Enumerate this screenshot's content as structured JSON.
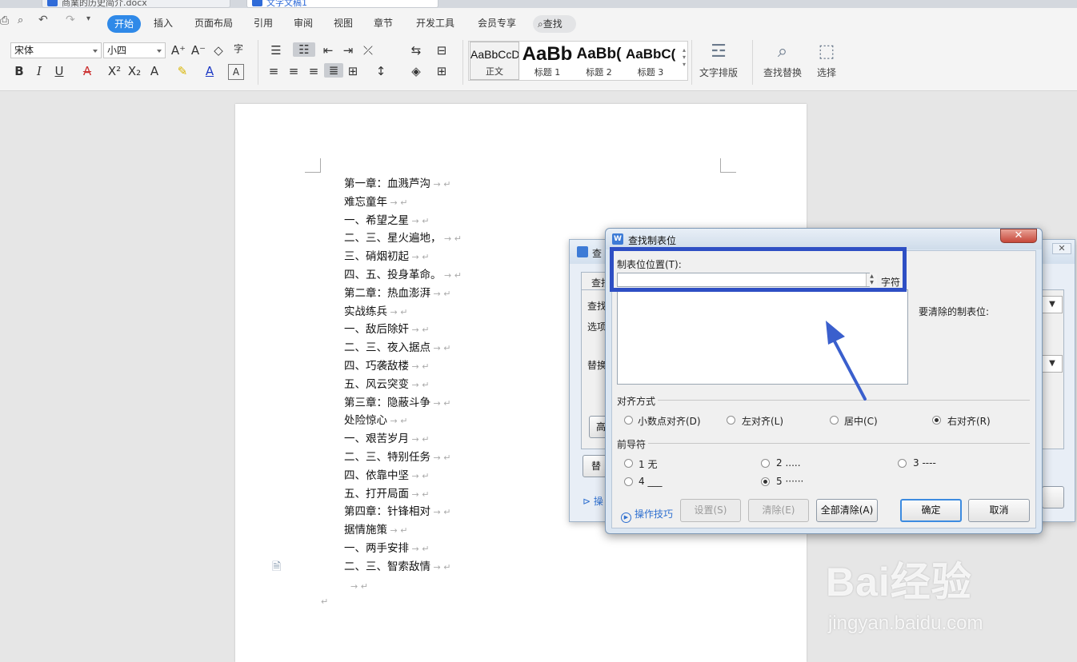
{
  "tabs": [
    {
      "label": "商業的历史简介.docx",
      "active": false
    },
    {
      "label": "文字文稿1",
      "active": true
    }
  ],
  "menu": {
    "items": [
      "插入",
      "页面布局",
      "引用",
      "审阅",
      "视图",
      "章节",
      "开发工具",
      "会员专享"
    ],
    "active": "开始",
    "search": "查找"
  },
  "ribbon": {
    "font_name": "宋体",
    "font_size": "小四",
    "styles": [
      {
        "preview": "AaBbCcD",
        "name": "正文"
      },
      {
        "preview": "AaBb",
        "name": "标题 1"
      },
      {
        "preview": "AaBb(",
        "name": "标题 2"
      },
      {
        "preview": "AaBbC(",
        "name": "标题 3"
      }
    ],
    "text_layout": "文字排版",
    "find_replace": "查找替换",
    "select": "选择"
  },
  "document": {
    "lines": [
      "第一章：血溅芦沟",
      "难忘童年",
      "一、希望之星",
      "二、三、星火遍地，",
      "三、硝烟初起",
      "四、五、投身革命。",
      "第二章：热血澎湃",
      "实战练兵",
      "一、敌后除奸",
      "二、三、夜入据点",
      "四、巧袭敌楼",
      "五、风云突变",
      "第三章：隐蔽斗争",
      "处险惊心",
      "一、艰苦岁月",
      "二、三、特别任务",
      "四、依靠中坚",
      "五、打开局面",
      "第四章：针锋相对",
      "据情施策",
      "一、两手安排",
      "二、三、智索敌情"
    ]
  },
  "back_dialog": {
    "title": "查",
    "tab": "查找",
    "find_label": "查找",
    "options_label": "选项",
    "replace_label": "替换",
    "high_btn": "高",
    "replace_btn": "替",
    "tips": "操"
  },
  "tab_dialog": {
    "title": "查找制表位",
    "position_label": "制表位位置(T):",
    "position_value": "",
    "unit": "字符",
    "clear_label": "要清除的制表位:",
    "align_group": "对齐方式",
    "align_options": [
      "小数点对齐(D)",
      "左对齐(L)",
      "居中(C)",
      "右对齐(R)"
    ],
    "align_selected": "右对齐(R)",
    "leader_group": "前导符",
    "leader_options": [
      "1 无",
      "2 .....",
      "3 ----",
      "4 ___",
      "5 ······"
    ],
    "leader_selected": "5 ······",
    "tips": "操作技巧",
    "buttons": {
      "set": "设置(S)",
      "clear": "清除(E)",
      "clear_all": "全部清除(A)",
      "ok": "确定",
      "cancel": "取消"
    }
  },
  "watermark": {
    "logo": "Bai经验",
    "url": "jingyan.baidu.com"
  },
  "colors": {
    "accent": "#2f89e8",
    "highlight": "#2e4fc4",
    "arrow": "#3a5fcd"
  }
}
